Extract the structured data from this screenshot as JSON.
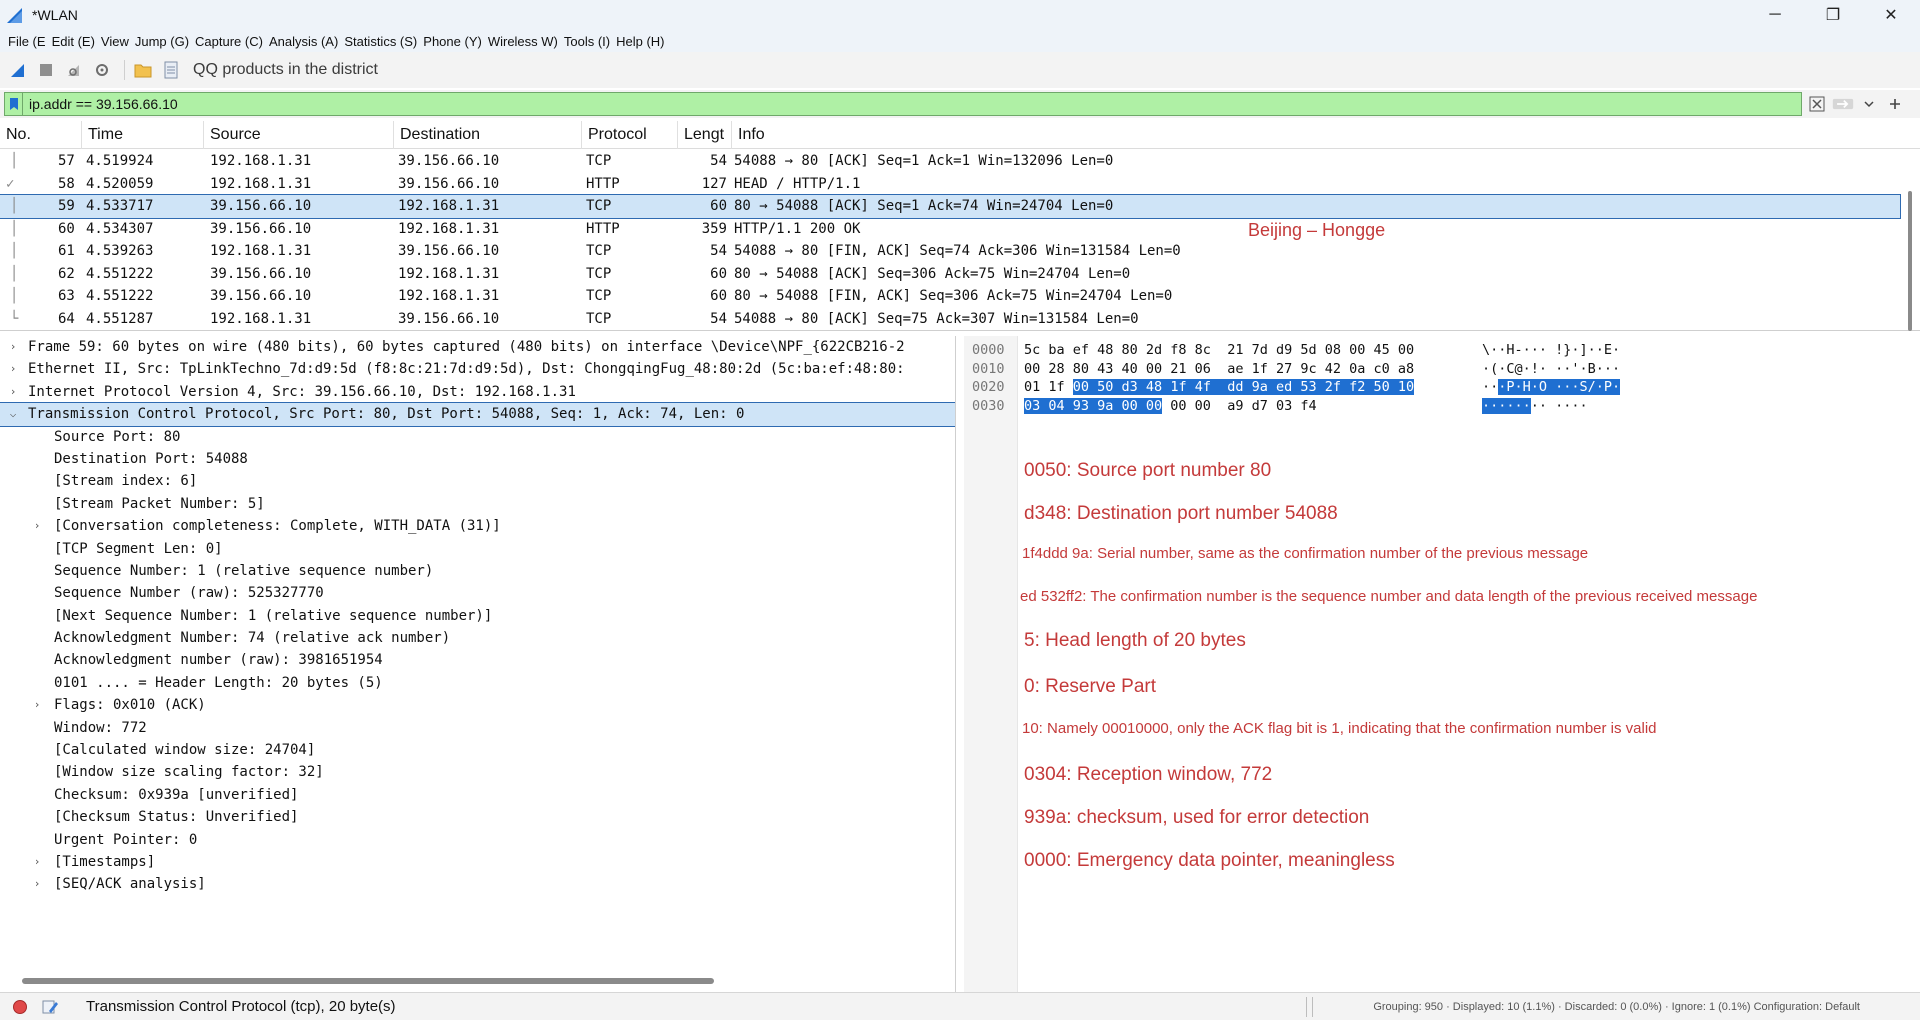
{
  "window": {
    "title": "*WLAN",
    "minimize_glyph": "─",
    "restore_glyph": "❐",
    "close_glyph": "✕"
  },
  "menu": [
    "File (E",
    "Edit (E)",
    "View",
    "Jump (G)",
    "Capture (C)",
    "Analysis (A)",
    "Statistics (S)",
    "Phone (Y)",
    "Wireless W)",
    "Tools (I)",
    "Help (H)"
  ],
  "toolbar": {
    "text": "QQ products in the district"
  },
  "filter": {
    "value": "ip.addr == 39.156.66.10"
  },
  "packet_list": {
    "columns": [
      "No.",
      "Time",
      "Source",
      "Destination",
      "Protocol",
      "Lengt",
      "Info"
    ],
    "rows": [
      {
        "no": "57",
        "time": "4.519924",
        "src": "192.168.1.31",
        "dst": "39.156.66.10",
        "proto": "TCP",
        "len": "54",
        "info": "54088 → 80 [ACK] Seq=1 Ack=1 Win=132096 Len=0"
      },
      {
        "no": "58",
        "time": "4.520059",
        "src": "192.168.1.31",
        "dst": "39.156.66.10",
        "proto": "HTTP",
        "len": "127",
        "info": "HEAD / HTTP/1.1"
      },
      {
        "no": "59",
        "time": "4.533717",
        "src": "39.156.66.10",
        "dst": "192.168.1.31",
        "proto": "TCP",
        "len": "60",
        "info": "80 → 54088 [ACK] Seq=1 Ack=74 Win=24704 Len=0"
      },
      {
        "no": "60",
        "time": "4.534307",
        "src": "39.156.66.10",
        "dst": "192.168.1.31",
        "proto": "HTTP",
        "len": "359",
        "info": "HTTP/1.1 200 OK"
      },
      {
        "no": "61",
        "time": "4.539263",
        "src": "192.168.1.31",
        "dst": "39.156.66.10",
        "proto": "TCP",
        "len": "54",
        "info": "54088 → 80 [FIN, ACK] Seq=74 Ack=306 Win=131584 Len=0"
      },
      {
        "no": "62",
        "time": "4.551222",
        "src": "39.156.66.10",
        "dst": "192.168.1.31",
        "proto": "TCP",
        "len": "60",
        "info": "80 → 54088 [ACK] Seq=306 Ack=75 Win=24704 Len=0"
      },
      {
        "no": "63",
        "time": "4.551222",
        "src": "39.156.66.10",
        "dst": "192.168.1.31",
        "proto": "TCP",
        "len": "60",
        "info": "80 → 54088 [FIN, ACK] Seq=306 Ack=75 Win=24704 Len=0"
      },
      {
        "no": "64",
        "time": "4.551287",
        "src": "192.168.1.31",
        "dst": "39.156.66.10",
        "proto": "TCP",
        "len": "54",
        "info": "54088 → 80 [ACK] Seq=75 Ack=307 Win=131584 Len=0"
      }
    ],
    "overlay_note": "Beijing – Hongge"
  },
  "details": [
    {
      "expander": "closed",
      "indent": 0,
      "text": "Frame 59: 60 bytes on wire (480 bits), 60 bytes captured (480 bits) on interface \\Device\\NPF_{622CB216-2"
    },
    {
      "expander": "closed",
      "indent": 0,
      "text": "Ethernet II, Src: TpLinkTechno_7d:d9:5d (f8:8c:21:7d:d9:5d), Dst: ChongqingFug_48:80:2d (5c:ba:ef:48:80:"
    },
    {
      "expander": "closed",
      "indent": 0,
      "text": "Internet Protocol Version 4, Src: 39.156.66.10, Dst: 192.168.1.31"
    },
    {
      "expander": "open",
      "indent": 0,
      "text": "Transmission Control Protocol, Src Port: 80, Dst Port: 54088, Seq: 1, Ack: 74, Len: 0"
    },
    {
      "expander": "",
      "indent": 1,
      "text": "Source Port: 80"
    },
    {
      "expander": "",
      "indent": 1,
      "text": "Destination Port: 54088"
    },
    {
      "expander": "",
      "indent": 1,
      "text": "[Stream index: 6]"
    },
    {
      "expander": "",
      "indent": 1,
      "text": "[Stream Packet Number: 5]"
    },
    {
      "expander": "closed",
      "indent": 1,
      "text": "[Conversation completeness: Complete, WITH_DATA (31)]"
    },
    {
      "expander": "",
      "indent": 1,
      "text": "[TCP Segment Len: 0]"
    },
    {
      "expander": "",
      "indent": 1,
      "text": "Sequence Number: 1    (relative sequence number)"
    },
    {
      "expander": "",
      "indent": 1,
      "text": "Sequence Number (raw): 525327770"
    },
    {
      "expander": "",
      "indent": 1,
      "text": "[Next Sequence Number: 1    (relative sequence number)]"
    },
    {
      "expander": "",
      "indent": 1,
      "text": "Acknowledgment Number: 74    (relative ack number)"
    },
    {
      "expander": "",
      "indent": 1,
      "text": "Acknowledgment number (raw): 3981651954"
    },
    {
      "expander": "",
      "indent": 1,
      "text": "0101 .... = Header Length: 20 bytes (5)"
    },
    {
      "expander": "closed",
      "indent": 1,
      "text": "Flags: 0x010 (ACK)"
    },
    {
      "expander": "",
      "indent": 1,
      "text": "Window: 772"
    },
    {
      "expander": "",
      "indent": 1,
      "text": "[Calculated window size: 24704]"
    },
    {
      "expander": "",
      "indent": 1,
      "text": "[Window size scaling factor: 32]"
    },
    {
      "expander": "",
      "indent": 1,
      "text": "Checksum: 0x939a [unverified]"
    },
    {
      "expander": "",
      "indent": 1,
      "text": "[Checksum Status: Unverified]"
    },
    {
      "expander": "",
      "indent": 1,
      "text": "Urgent Pointer: 0"
    },
    {
      "expander": "closed",
      "indent": 1,
      "text": "[Timestamps]"
    },
    {
      "expander": "closed",
      "indent": 1,
      "text": "[SEQ/ACK analysis]"
    }
  ],
  "bytes": {
    "rows": [
      {
        "offset": "0000",
        "hex_pre": "5c ba ef 48 80 2d f8 8c  21 7d d9 5d 08 00 45 00",
        "hex_hl": "",
        "hex_post": "",
        "ascii_pre": "\\··H-··· !}·]··E·",
        "ascii_hl": "",
        "ascii_post": ""
      },
      {
        "offset": "0010",
        "hex_pre": "00 28 80 43 40 00 21 06  ae 1f 27 9c 42 0a c0 a8",
        "hex_hl": "",
        "hex_post": "",
        "ascii_pre": "·(·C@·!· ··'·B···",
        "ascii_hl": "",
        "ascii_post": ""
      },
      {
        "offset": "0020",
        "hex_pre": "01 1f ",
        "hex_hl": "00 50 d3 48 1f 4f  dd 9a ed 53 2f f2 50 10",
        "hex_post": "",
        "ascii_pre": "··",
        "ascii_hl": "·P·H·O ···S/·P·",
        "ascii_post": ""
      },
      {
        "offset": "0030",
        "hex_pre": "",
        "hex_hl": "03 04 93 9a 00 00",
        "hex_post": " 00 00  a9 d7 03 f4",
        "ascii_pre": "",
        "ascii_hl": "······",
        "ascii_post": "·· ····"
      }
    ]
  },
  "annotations": [
    {
      "text": "0050: Source port number 80",
      "size": "big"
    },
    {
      "text": "d348: Destination port number 54088",
      "size": "big"
    },
    {
      "text": "1f4ddd 9a: Serial number, same as the confirmation number of the previous message",
      "size": "small"
    },
    {
      "text": "ed 532ff2: The confirmation number is the sequence number and data length of the previous received message",
      "size": "small"
    },
    {
      "text": "5: Head length of 20 bytes",
      "size": "big"
    },
    {
      "text": "0: Reserve Part",
      "size": "big"
    },
    {
      "text": "10: Namely 00010000, only the ACK flag bit is 1, indicating that the confirmation number is valid",
      "size": "small"
    },
    {
      "text": "0304: Reception window, 772",
      "size": "big"
    },
    {
      "text": "939a: checksum, used for error detection",
      "size": "big"
    },
    {
      "text": "0000: Emergency data pointer, meaningless",
      "size": "big"
    }
  ],
  "status": {
    "text": "Transmission Control Protocol (tcp), 20 byte(s)",
    "right": "Grouping: 950 · Displayed: 10 (1.1%) · Discarded: 0 (0.0%) · Ignore: 1 (0.1%) Configuration: Default"
  },
  "colors": {
    "accent": "#1f6fd1",
    "selection": "#cfe4f7",
    "filter_ok": "#aff0a5",
    "annotation": "#c43a3a"
  }
}
